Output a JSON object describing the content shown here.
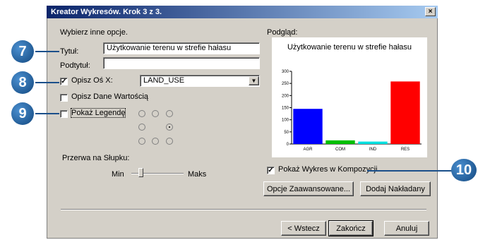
{
  "dialog": {
    "title": "Kreator Wykresów. Krok 3 z 3.",
    "close_glyph": "×",
    "instruction": "Wybierz inne opcje.",
    "preview_label": "Podgląd:"
  },
  "form": {
    "title_label": "Tytuł:",
    "title_value": "Użytkowanie terenu w strefie hałasu",
    "subtitle_label": "Podtytuł:",
    "subtitle_value": "",
    "axis_x_label": "Opisz Oś X:",
    "axis_x_checked": true,
    "axis_x_value": "LAND_USE",
    "data_values_label": "Opisz Dane Wartością",
    "data_values_checked": false,
    "legend_label": "Pokaż Legendę",
    "legend_checked": false,
    "legend_position_selected": "middle-right",
    "bar_gap_label": "Przerwa na Słupku:",
    "slider_min_label": "Min",
    "slider_max_label": "Maks",
    "show_in_layout_label": "Pokaż Wykres w Kompozycji",
    "show_in_layout_checked": true
  },
  "buttons": {
    "advanced": "Opcje Zaawansowane...",
    "add_overlay": "Dodaj Nakładany",
    "back": "< Wstecz",
    "finish": "Zakończ",
    "cancel": "Anuluj"
  },
  "markers": {
    "m7": "7",
    "m8": "8",
    "m9": "9",
    "m10": "10"
  },
  "colors": {
    "marker": "#1f5c99",
    "titlebar": "#0a246a"
  },
  "chart_data": {
    "type": "bar",
    "title": "Użytkowanie terenu w strefie hałasu",
    "categories": [
      "AGR",
      "COM",
      "IND",
      "RES"
    ],
    "values": [
      145,
      15,
      10,
      258
    ],
    "colors": [
      "#0000ff",
      "#00c000",
      "#00e0e0",
      "#ff0000"
    ],
    "ylim": [
      0,
      300
    ],
    "yticks": [
      0,
      50,
      100,
      150,
      200,
      250,
      300
    ],
    "xlabel": "",
    "ylabel": ""
  }
}
